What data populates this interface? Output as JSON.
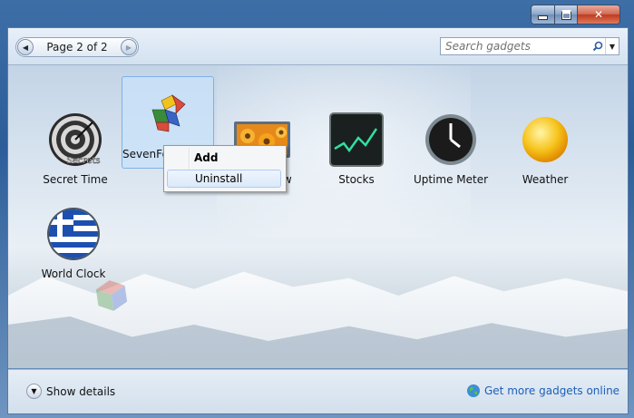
{
  "window": {
    "buttons": {
      "minimize": "minimize",
      "maximize": "maximize",
      "close": "✕"
    }
  },
  "toolbar": {
    "page_label": "Page 2 of 2",
    "prev_glyph": "◀",
    "next_glyph": "▶",
    "search_placeholder": "Search gadgets",
    "search_dropdown_glyph": "▼"
  },
  "gadgets": [
    {
      "label": "Secret Time",
      "icon": "secret-target-icon",
      "icon_text": "Secrets"
    },
    {
      "label": "SevenForums M...",
      "icon": "sevenforums-cube-icon",
      "selected": true
    },
    {
      "label": "Slide Show",
      "icon": "slideshow-flowers-icon"
    },
    {
      "label": "Stocks",
      "icon": "stocks-chart-icon"
    },
    {
      "label": "Uptime Meter",
      "icon": "clock-icon"
    },
    {
      "label": "Weather",
      "icon": "sun-icon"
    },
    {
      "label": "World Clock",
      "icon": "greek-flag-icon"
    }
  ],
  "context_menu": {
    "add_label": "Add",
    "uninstall_label": "Uninstall"
  },
  "bottom": {
    "details_glyph": "▼",
    "details_label": "Show details",
    "more_link": "Get more gadgets online"
  },
  "colors": {
    "link": "#1d5fb8",
    "selection": "#c8e1fa",
    "close_button": "#c0391f"
  }
}
